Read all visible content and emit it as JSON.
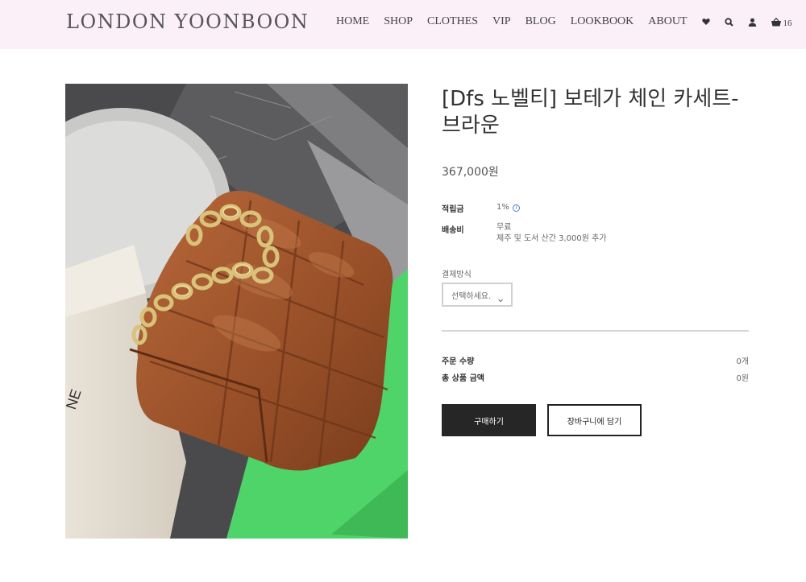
{
  "header": {
    "logo": "LONDON YOONBOON",
    "nav": [
      "HOME",
      "SHOP",
      "CLOTHES",
      "VIP",
      "BLOG",
      "LOOKBOOK",
      "ABOUT"
    ],
    "cart_count": "16"
  },
  "product": {
    "title": "[Dfs 노벨티] 보테가 체인 카세트-브라운",
    "price": "367,000원",
    "points_label": "적립금",
    "points_value": "1%",
    "shipping_label": "배송비",
    "shipping_value": "무료",
    "shipping_note": "제주 및 도서 산간 3,000원 추가",
    "payment_label": "결제방식",
    "payment_placeholder": "선택하세요.",
    "qty_label": "주문 수량",
    "qty_value": "0개",
    "total_label": "총 상품 금액",
    "total_value": "0원",
    "buy_label": "구매하기",
    "cart_label": "장바구니에 담기"
  },
  "colors": {
    "header_bg": "#fbeff8",
    "buy_button": "#262626",
    "bag": "#a0582e",
    "green_box": "#4fd46a"
  }
}
